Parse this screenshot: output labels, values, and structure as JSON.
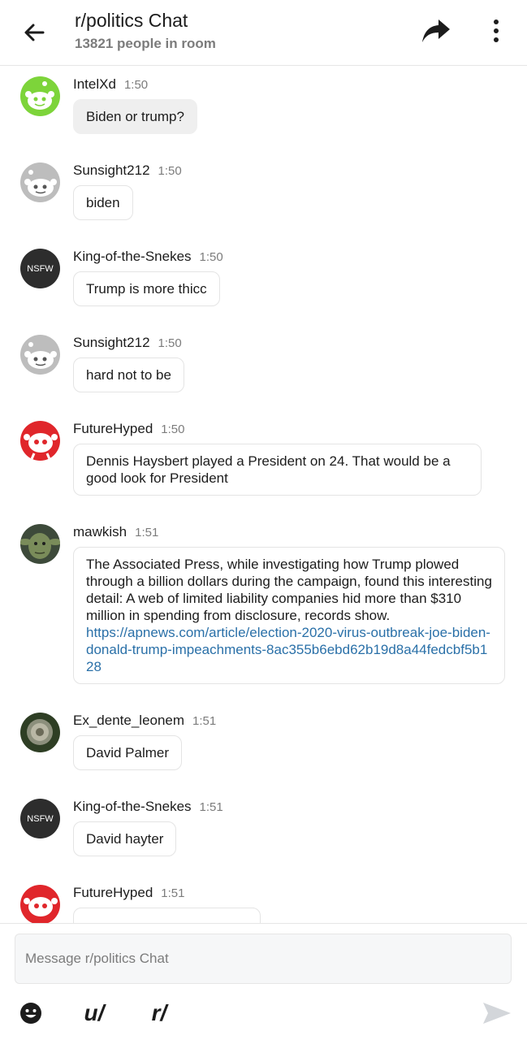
{
  "header": {
    "title": "r/politics Chat",
    "subtitle": "13821 people in room"
  },
  "messages": [
    {
      "username": "IntelXd",
      "time": "1:50",
      "text": "Biden or trump?"
    },
    {
      "username": "Sunsight212",
      "time": "1:50",
      "text": "biden"
    },
    {
      "username": "King-of-the-Snekes",
      "time": "1:50",
      "text": "Trump is more thicc",
      "avatar_label": "NSFW"
    },
    {
      "username": "Sunsight212",
      "time": "1:50",
      "text": "hard not to be"
    },
    {
      "username": "FutureHyped",
      "time": "1:50",
      "text": "Dennis Haysbert played a President on 24. That would be a good look for President"
    },
    {
      "username": "mawkish",
      "time": "1:51",
      "text": "The Associated Press, while investigating how Trump plowed through a billion dollars during the campaign, found this interesting detail: A web of limited liability companies hid more than $310 million in spending from disclosure, records show.",
      "link": "https://apnews.com/article/election-2020-virus-outbreak-joe-biden-donald-trump-impeachments-8ac355b6ebd62b19d8a44fedcbf5b128"
    },
    {
      "username": "Ex_dente_leonem",
      "time": "1:51",
      "text": "David Palmer"
    },
    {
      "username": "King-of-the-Snekes",
      "time": "1:51",
      "text": "David hayter",
      "avatar_label": "NSFW"
    },
    {
      "username": "FutureHyped",
      "time": "1:51",
      "text": ""
    }
  ],
  "composer": {
    "placeholder": "Message r/politics Chat",
    "user_tool": "u/",
    "sub_tool": "r/"
  },
  "icons": {
    "back": "back-arrow-icon",
    "share": "share-icon",
    "more": "more-vertical-icon",
    "emoji": "emoji-icon",
    "send": "send-icon"
  },
  "colors": {
    "link": "#2a70a8",
    "muted": "#7c7c7c",
    "avatar_green": "#7dd43a",
    "avatar_red": "#e0262b"
  }
}
